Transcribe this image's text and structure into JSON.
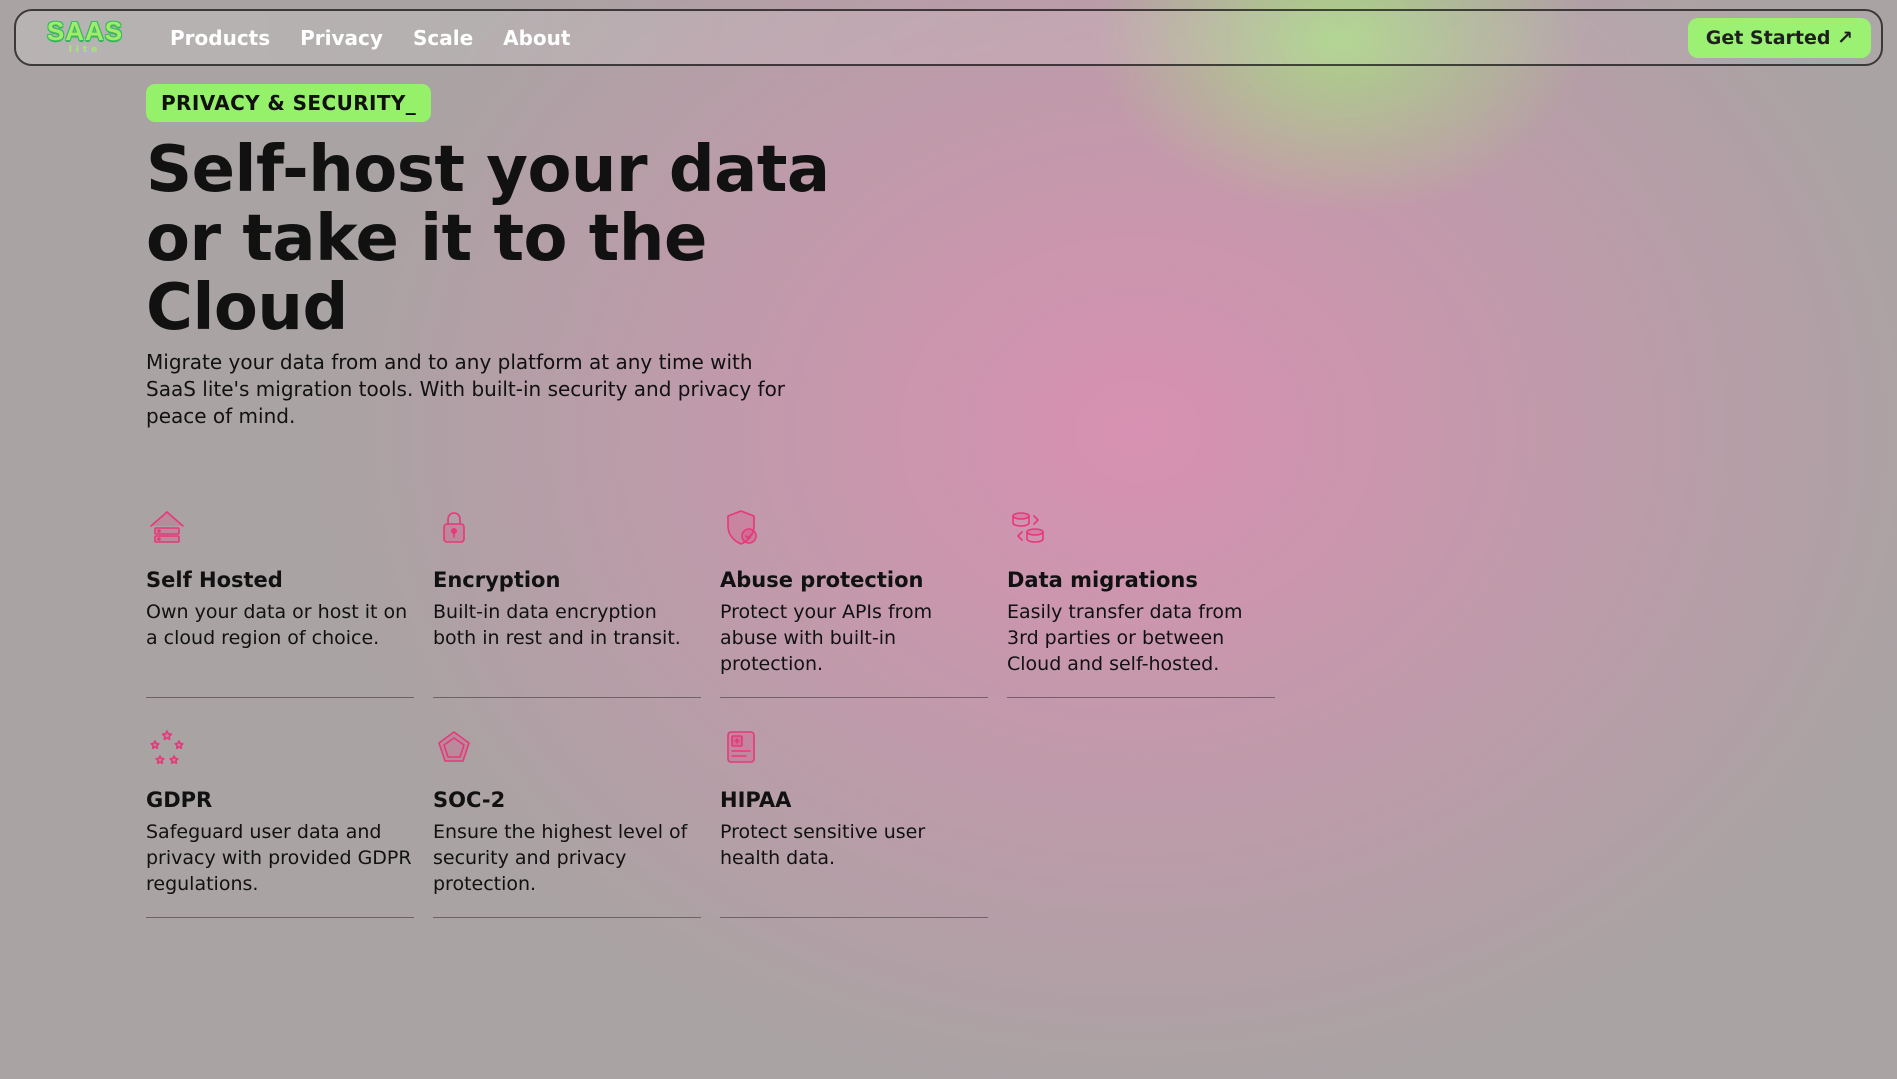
{
  "nav": {
    "logo_top": "SAAS",
    "logo_sub": "lite",
    "links": [
      "Products",
      "Privacy",
      "Scale",
      "About"
    ],
    "cta": "Get Started ↗"
  },
  "hero": {
    "badge": "PRIVACY & SECURITY_",
    "title": "Self-host your data or take it to the Cloud",
    "subhead": "Migrate your data from and to any platform at any time with SaaS lite's migration tools. With built-in security and privacy for peace of mind."
  },
  "features": [
    {
      "icon": "home-server-icon",
      "title": "Self Hosted",
      "desc": "Own your data or host it on a cloud region of choice."
    },
    {
      "icon": "lock-icon",
      "title": "Encryption",
      "desc": "Built-in data encryption both in rest and in transit."
    },
    {
      "icon": "shield-check-icon",
      "title": "Abuse protection",
      "desc": "Protect your APIs from abuse with built-in protection."
    },
    {
      "icon": "db-sync-icon",
      "title": "Data migrations",
      "desc": "Easily transfer data from 3rd parties or between Cloud and self-hosted."
    },
    {
      "icon": "stars-circle-icon",
      "title": "GDPR",
      "desc": "Safeguard user data and privacy with provided GDPR regulations."
    },
    {
      "icon": "pentagon-icon",
      "title": "SOC-2",
      "desc": "Ensure the highest level of security and privacy protection."
    },
    {
      "icon": "medical-doc-icon",
      "title": "HIPAA",
      "desc": "Protect sensitive user health data."
    }
  ]
}
